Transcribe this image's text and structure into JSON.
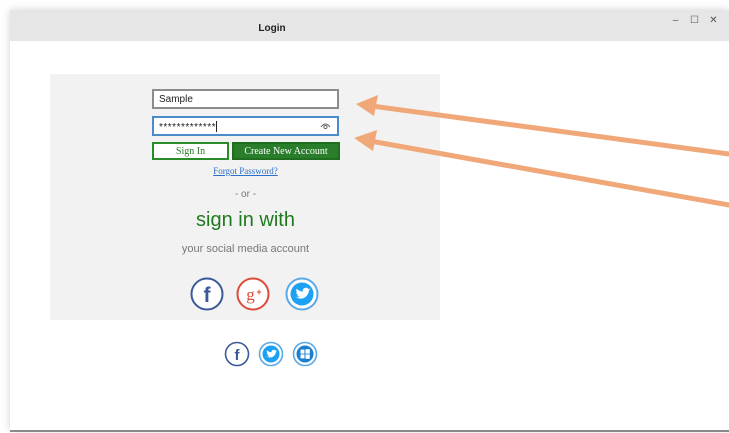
{
  "window": {
    "title": "Login",
    "controls": {
      "minimize": "–",
      "maximize": "☐",
      "close": "✕"
    }
  },
  "form": {
    "username_value": "Sample",
    "password_value": "*************",
    "signin_label": "Sign In",
    "create_account_label": "Create New Account",
    "forgot_label": "Forgot Password?"
  },
  "social": {
    "or_label": "- or -",
    "heading": "sign in with",
    "subheading": "your social media account",
    "primary_icons": [
      "facebook-icon",
      "google-plus-icon",
      "twitter-icon"
    ],
    "secondary_icons": [
      "facebook-icon",
      "twitter-icon",
      "windows-icon"
    ]
  },
  "colors": {
    "facebook": "#3b5998",
    "google_plus": "#dd4b39",
    "twitter": "#1da1f2",
    "green": "#2a7d2a",
    "arrow": "#f0a878"
  }
}
